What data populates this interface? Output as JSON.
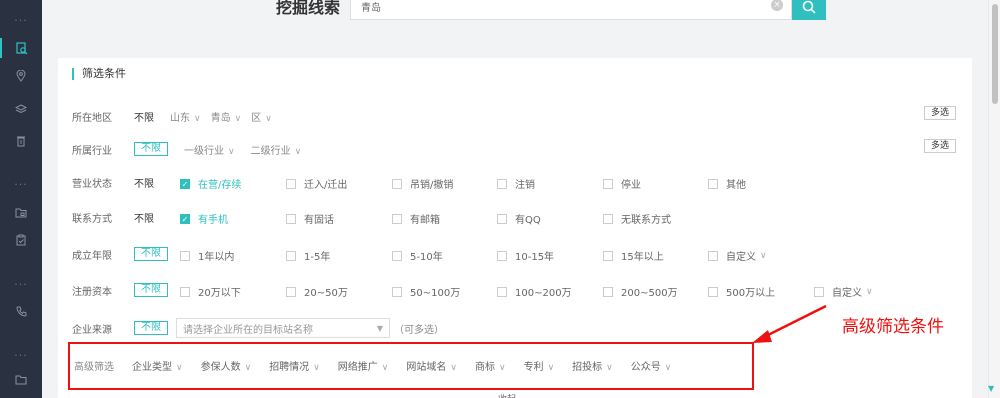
{
  "sidebar": {
    "icons": [
      "dots-icon",
      "document-search-icon",
      "location-pin-icon",
      "layers-icon",
      "trash-icon",
      "dots-icon",
      "folder-grid-icon",
      "clipboard-icon",
      "dots-icon",
      "phone-icon",
      "dots-icon",
      "folder-icon"
    ]
  },
  "header": {
    "title": "挖掘线索",
    "search_value": "青岛"
  },
  "filter": {
    "title": "筛选条件",
    "multi_label": "多选",
    "region": {
      "label": "所在地区",
      "nolimit": "不限",
      "province": "山东",
      "city": "青岛",
      "district": "区"
    },
    "industry": {
      "label": "所属行业",
      "nolimit": "不限",
      "level1": "一级行业",
      "level2": "二级行业"
    },
    "status": {
      "label": "营业状态",
      "nolimit": "不限",
      "options": [
        "在营/存续",
        "迁入/迁出",
        "吊销/撤销",
        "注销",
        "停业",
        "其他"
      ]
    },
    "contact": {
      "label": "联系方式",
      "nolimit": "不限",
      "options": [
        "有手机",
        "有固话",
        "有邮箱",
        "有QQ",
        "无联系方式"
      ]
    },
    "years": {
      "label": "成立年限",
      "nolimit": "不限",
      "options": [
        "1年以内",
        "1-5年",
        "5-10年",
        "10-15年",
        "15年以上",
        "自定义"
      ]
    },
    "capital": {
      "label": "注册资本",
      "nolimit": "不限",
      "options": [
        "20万以下",
        "20~50万",
        "50~100万",
        "100~200万",
        "200~500万",
        "500万以上",
        "自定义"
      ]
    },
    "source": {
      "label": "企业来源",
      "nolimit": "不限",
      "placeholder": "请选择企业所在的目标站名称",
      "hint": "（可多选）"
    },
    "advanced": {
      "label": "高级筛选",
      "items": [
        "企业类型",
        "参保人数",
        "招聘情况",
        "网络推广",
        "网站域名",
        "商标",
        "专利",
        "招投标",
        "公众号"
      ]
    },
    "footer": "收起"
  },
  "annotation": {
    "text": "高级筛选条件",
    "color": "#ee1111"
  },
  "colors": {
    "accent": "#2fbfbf",
    "sidebar": "#2a3140",
    "annotation": "#ee1111"
  }
}
